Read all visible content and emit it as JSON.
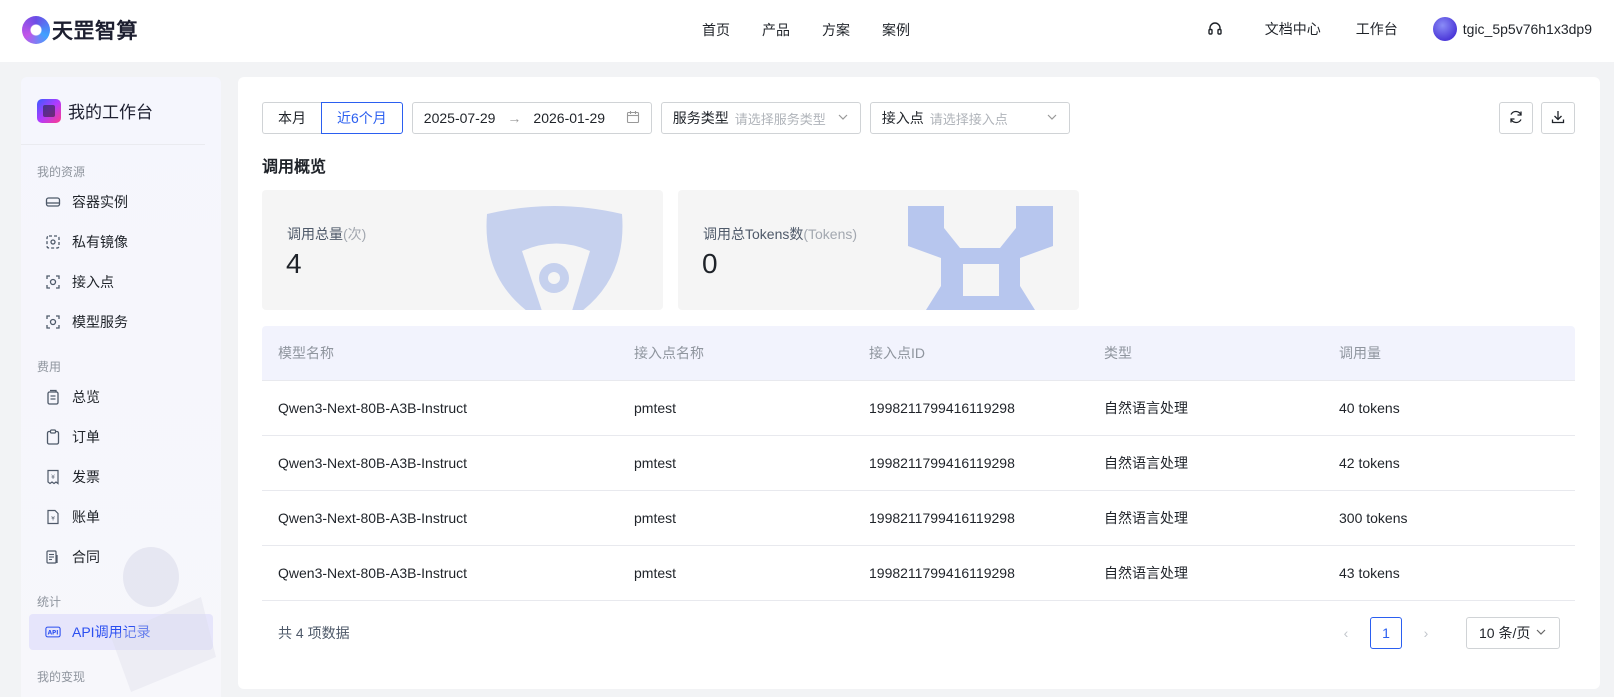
{
  "brand": {
    "name": "天罡智算"
  },
  "topnav": {
    "items": [
      "首页",
      "产品",
      "方案",
      "案例"
    ]
  },
  "topright": {
    "docs": "文档中心",
    "workbench": "工作台",
    "username": "tgic_5p5v76h1x3dp9"
  },
  "sidebar": {
    "title": "我的工作台",
    "sections": [
      {
        "title": "我的资源",
        "items": [
          {
            "label": "容器实例",
            "icon": "drive-icon"
          },
          {
            "label": "私有镜像",
            "icon": "image-icon"
          },
          {
            "label": "接入点",
            "icon": "endpoint-icon"
          },
          {
            "label": "模型服务",
            "icon": "model-service-icon"
          }
        ]
      },
      {
        "title": "费用",
        "items": [
          {
            "label": "总览",
            "icon": "overview-icon"
          },
          {
            "label": "订单",
            "icon": "order-icon"
          },
          {
            "label": "发票",
            "icon": "invoice-icon"
          },
          {
            "label": "账单",
            "icon": "bill-icon"
          },
          {
            "label": "合同",
            "icon": "contract-icon"
          }
        ]
      },
      {
        "title": "统计",
        "items": [
          {
            "label": "API调用记录",
            "icon": "api-icon",
            "active": true
          }
        ]
      },
      {
        "title": "我的变现",
        "items": []
      }
    ]
  },
  "filters": {
    "this_month": "本月",
    "last_6_months": "近6个月",
    "date_start": "2025-07-29",
    "date_end": "2026-01-29",
    "service_type_label": "服务类型",
    "service_type_placeholder": "请选择服务类型",
    "endpoint_label": "接入点",
    "endpoint_placeholder": "请选择接入点"
  },
  "overview": {
    "title": "调用概览",
    "total_calls_label": "调用总量",
    "total_calls_unit": "(次)",
    "total_calls_value": "4",
    "total_tokens_label": "调用总Tokens数",
    "total_tokens_unit": "(Tokens)",
    "total_tokens_value": "0"
  },
  "table": {
    "columns": [
      "模型名称",
      "接入点名称",
      "接入点ID",
      "类型",
      "调用量"
    ],
    "rows": [
      [
        "Qwen3-Next-80B-A3B-Instruct",
        "pmtest",
        "1998211799416119298",
        "自然语言处理",
        "40 tokens"
      ],
      [
        "Qwen3-Next-80B-A3B-Instruct",
        "pmtest",
        "1998211799416119298",
        "自然语言处理",
        "42 tokens"
      ],
      [
        "Qwen3-Next-80B-A3B-Instruct",
        "pmtest",
        "1998211799416119298",
        "自然语言处理",
        "300 tokens"
      ],
      [
        "Qwen3-Next-80B-A3B-Instruct",
        "pmtest",
        "1998211799416119298",
        "自然语言处理",
        "43 tokens"
      ]
    ]
  },
  "pagination": {
    "total_text": "共 4 项数据",
    "current_page": "1",
    "page_size": "10 条/页"
  },
  "colors": {
    "accent": "#2b5ff0",
    "active_bg": "#e6e5fb",
    "header_row_bg": "#f2f3fd"
  }
}
